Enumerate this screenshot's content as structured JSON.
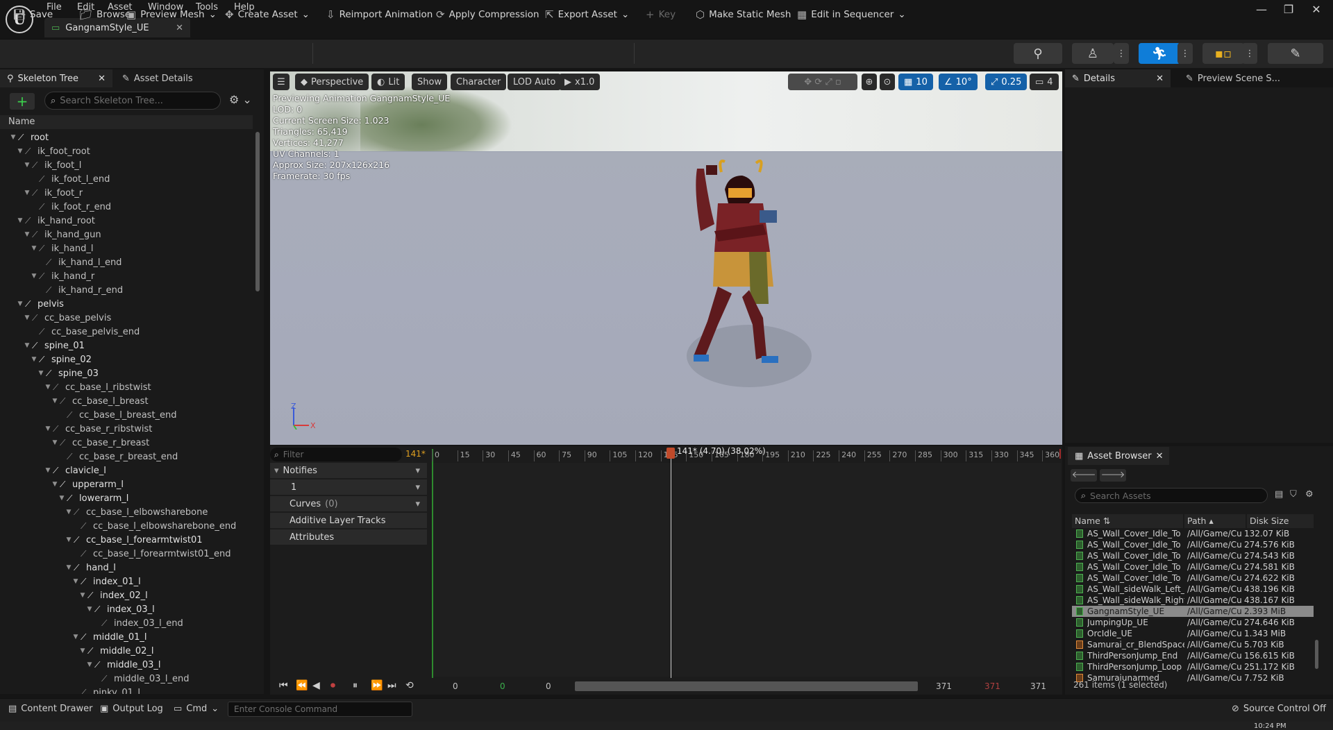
{
  "menu": {
    "file": "File",
    "edit": "Edit",
    "asset": "Asset",
    "window": "Window",
    "tools": "Tools",
    "help": "Help"
  },
  "document_tab": "GangnamStyle_UE",
  "toolbar": {
    "save": "Save",
    "browse": "Browse",
    "preview_mesh": "Preview Mesh",
    "create_asset": "Create Asset",
    "reimport": "Reimport Animation",
    "apply_compression": "Apply Compression",
    "export_asset": "Export Asset",
    "key": "Key",
    "make_static_mesh": "Make Static Mesh",
    "edit_in_sequencer": "Edit in Sequencer"
  },
  "left_panel": {
    "tab_skeleton": "Skeleton Tree",
    "tab_details": "Asset Details",
    "search_placeholder": "Search Skeleton Tree...",
    "name_header": "Name",
    "bones": [
      {
        "label": "root",
        "depth": 0,
        "white": true
      },
      {
        "label": "ik_foot_root",
        "depth": 1,
        "white": false
      },
      {
        "label": "ik_foot_l",
        "depth": 2,
        "white": false
      },
      {
        "label": "ik_foot_l_end",
        "depth": 3,
        "white": false
      },
      {
        "label": "ik_foot_r",
        "depth": 2,
        "white": false
      },
      {
        "label": "ik_foot_r_end",
        "depth": 3,
        "white": false
      },
      {
        "label": "ik_hand_root",
        "depth": 1,
        "white": false
      },
      {
        "label": "ik_hand_gun",
        "depth": 2,
        "white": false
      },
      {
        "label": "ik_hand_l",
        "depth": 3,
        "white": false
      },
      {
        "label": "ik_hand_l_end",
        "depth": 4,
        "white": false
      },
      {
        "label": "ik_hand_r",
        "depth": 3,
        "white": false
      },
      {
        "label": "ik_hand_r_end",
        "depth": 4,
        "white": false
      },
      {
        "label": "pelvis",
        "depth": 1,
        "white": true
      },
      {
        "label": "cc_base_pelvis",
        "depth": 2,
        "white": false
      },
      {
        "label": "cc_base_pelvis_end",
        "depth": 3,
        "white": false
      },
      {
        "label": "spine_01",
        "depth": 2,
        "white": true
      },
      {
        "label": "spine_02",
        "depth": 3,
        "white": true
      },
      {
        "label": "spine_03",
        "depth": 4,
        "white": true
      },
      {
        "label": "cc_base_l_ribstwist",
        "depth": 5,
        "white": false
      },
      {
        "label": "cc_base_l_breast",
        "depth": 6,
        "white": false
      },
      {
        "label": "cc_base_l_breast_end",
        "depth": 7,
        "white": false
      },
      {
        "label": "cc_base_r_ribstwist",
        "depth": 5,
        "white": false
      },
      {
        "label": "cc_base_r_breast",
        "depth": 6,
        "white": false
      },
      {
        "label": "cc_base_r_breast_end",
        "depth": 7,
        "white": false
      },
      {
        "label": "clavicle_l",
        "depth": 5,
        "white": true
      },
      {
        "label": "upperarm_l",
        "depth": 6,
        "white": true
      },
      {
        "label": "lowerarm_l",
        "depth": 7,
        "white": true
      },
      {
        "label": "cc_base_l_elbowsharebone",
        "depth": 8,
        "white": false
      },
      {
        "label": "cc_base_l_elbowsharebone_end",
        "depth": 9,
        "white": false
      },
      {
        "label": "cc_base_l_forearmtwist01",
        "depth": 8,
        "white": true
      },
      {
        "label": "cc_base_l_forearmtwist01_end",
        "depth": 9,
        "white": false
      },
      {
        "label": "hand_l",
        "depth": 8,
        "white": true
      },
      {
        "label": "index_01_l",
        "depth": 9,
        "white": true
      },
      {
        "label": "index_02_l",
        "depth": 10,
        "white": true
      },
      {
        "label": "index_03_l",
        "depth": 11,
        "white": true
      },
      {
        "label": "index_03_l_end",
        "depth": 12,
        "white": false
      },
      {
        "label": "middle_01_l",
        "depth": 9,
        "white": true
      },
      {
        "label": "middle_02_l",
        "depth": 10,
        "white": true
      },
      {
        "label": "middle_03_l",
        "depth": 11,
        "white": true
      },
      {
        "label": "middle_03_l_end",
        "depth": 12,
        "white": false
      },
      {
        "label": "pinky_01_l",
        "depth": 9,
        "white": false
      }
    ]
  },
  "viewport": {
    "perspective": "Perspective",
    "lit": "Lit",
    "show": "Show",
    "character": "Character",
    "lod": "LOD Auto",
    "speed": "x1.0",
    "grid_snap": "10",
    "rot_snap": "10°",
    "scale_snap": "0.25",
    "cam_speed": "4",
    "stats": [
      "Previewing Animation GangnamStyle_UE",
      "LOD: 0",
      "Current Screen Size: 1.023",
      "Triangles: 65,419",
      "Vertices: 41,277",
      "UV Channels: 1",
      "Approx Size: 207x126x216",
      "Framerate: 30 fps"
    ],
    "axis_z": "Z",
    "axis_x": "X"
  },
  "details_panel": {
    "tab_details": "Details",
    "tab_preview": "Preview Scene S..."
  },
  "timeline": {
    "filter_placeholder": "Filter",
    "frame_count": "141*",
    "notifies": "Notifies",
    "notify_track": "1",
    "curves": "Curves",
    "curves_count": "(0)",
    "additive": "Additive Layer Tracks",
    "attributes": "Attributes",
    "playhead_label": "141* (4.70) (38.02%)",
    "ticks": [
      "0",
      "15",
      "30",
      "45",
      "60",
      "75",
      "90",
      "105",
      "120",
      "135",
      "150",
      "165",
      "180",
      "195",
      "210",
      "225",
      "240",
      "255",
      "270",
      "285",
      "300",
      "315",
      "330",
      "345",
      "360"
    ],
    "range_start": "0",
    "range_green": "0",
    "range_view_start": "0",
    "range_view_end": "371",
    "range_red": "371",
    "range_end": "371"
  },
  "asset_browser": {
    "tab": "Asset Browser",
    "search_placeholder": "Search Assets",
    "col_name": "Name",
    "col_path": "Path",
    "col_size": "Disk Size",
    "rows": [
      {
        "name": "AS_Wall_Cover_Idle_To",
        "path": "/All/Game/Cu",
        "size": "132.07 KiB",
        "type": "anim"
      },
      {
        "name": "AS_Wall_Cover_Idle_To",
        "path": "/All/Game/Cu",
        "size": "274.576 KiB",
        "type": "anim"
      },
      {
        "name": "AS_Wall_Cover_Idle_To",
        "path": "/All/Game/Cu",
        "size": "274.543 KiB",
        "type": "anim"
      },
      {
        "name": "AS_Wall_Cover_Idle_To",
        "path": "/All/Game/Cu",
        "size": "274.581 KiB",
        "type": "anim"
      },
      {
        "name": "AS_Wall_Cover_Idle_To",
        "path": "/All/Game/Cu",
        "size": "274.622 KiB",
        "type": "anim"
      },
      {
        "name": "AS_Wall_sideWalk_Left_",
        "path": "/All/Game/Cu",
        "size": "438.196 KiB",
        "type": "anim"
      },
      {
        "name": "AS_Wall_sideWalk_Right",
        "path": "/All/Game/Cu",
        "size": "438.167 KiB",
        "type": "anim"
      },
      {
        "name": "GangnamStyle_UE",
        "path": "/All/Game/Cu",
        "size": "2.393 MiB",
        "type": "anim",
        "selected": true
      },
      {
        "name": "JumpingUp_UE",
        "path": "/All/Game/Cu",
        "size": "274.646 KiB",
        "type": "anim"
      },
      {
        "name": "OrcIdle_UE",
        "path": "/All/Game/Cu",
        "size": "1.343 MiB",
        "type": "anim"
      },
      {
        "name": "Samurai_cr_BlendSpace",
        "path": "/All/Game/Cu",
        "size": "5.703 KiB",
        "type": "blendspace"
      },
      {
        "name": "ThirdPersonJump_End",
        "path": "/All/Game/Cu",
        "size": "156.615 KiB",
        "type": "anim"
      },
      {
        "name": "ThirdPersonJump_Loop",
        "path": "/All/Game/Cu",
        "size": "251.172 KiB",
        "type": "anim"
      },
      {
        "name": "Samuraiunarmed",
        "path": "/All/Game/Cu",
        "size": "7.752 KiB",
        "type": "blendspace"
      }
    ],
    "count": "261 items (1 selected)"
  },
  "statusbar": {
    "content_drawer": "Content Drawer",
    "output_log": "Output Log",
    "cmd": "Cmd",
    "console_placeholder": "Enter Console Command",
    "source_control": "Source Control Off"
  },
  "taskbar_time": "10:24 PM",
  "colors": {
    "accent": "#0f7dd8",
    "selection": "#8a8a8a",
    "playhead": "#c04a2a",
    "add": "#3bd14c"
  }
}
